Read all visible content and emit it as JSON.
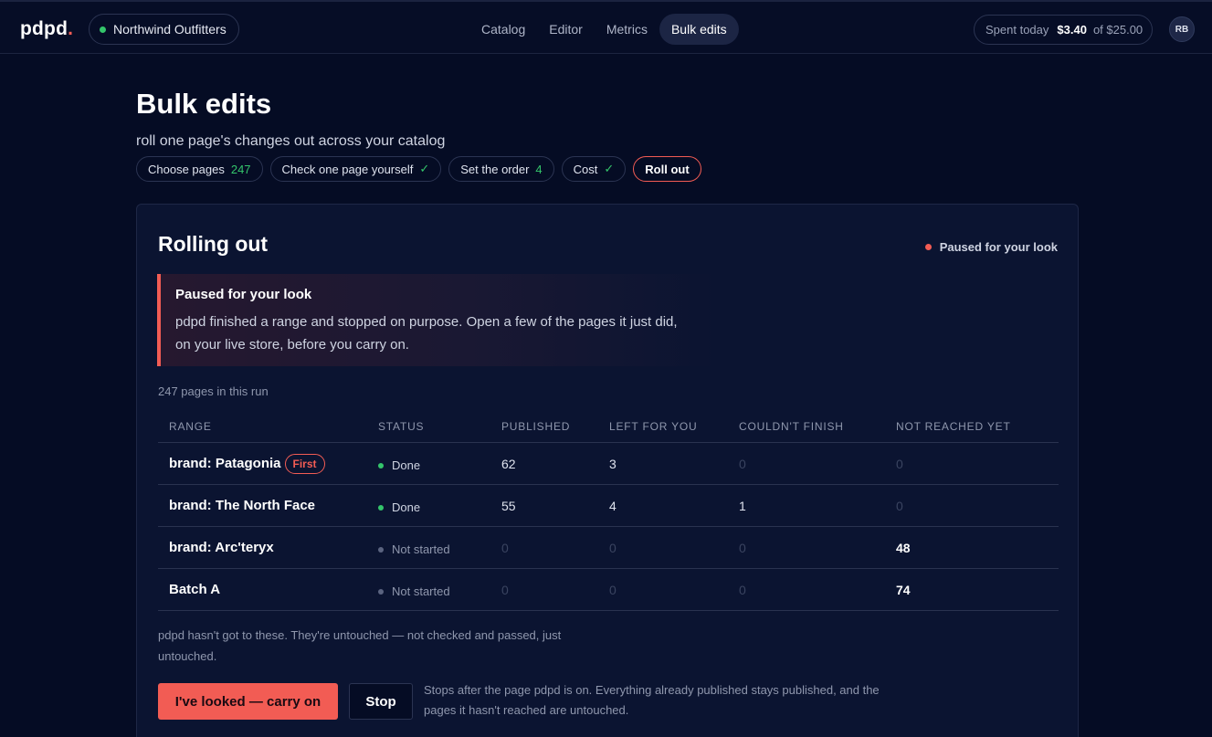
{
  "app": {
    "logo": "pdpd",
    "logo_dot": ".",
    "store_name": "Northwind Outfitters",
    "avatar_initials": "RB"
  },
  "nav": {
    "items": [
      {
        "label": "Catalog",
        "active": false
      },
      {
        "label": "Editor",
        "active": false
      },
      {
        "label": "Metrics",
        "active": false
      },
      {
        "label": "Bulk edits",
        "active": true
      }
    ]
  },
  "spend": {
    "label": "Spent today",
    "amount": "$3.40",
    "limit": "of $25.00"
  },
  "page": {
    "title": "Bulk edits",
    "subtitle": "roll one page's changes out across your catalog"
  },
  "steps": [
    {
      "label": "Choose pages",
      "extra": "247"
    },
    {
      "label": "Check one page yourself",
      "extra": "✓"
    },
    {
      "label": "Set the order",
      "extra": "4"
    },
    {
      "label": "Cost",
      "extra": "✓"
    },
    {
      "label": "Roll out",
      "extra": ""
    }
  ],
  "card": {
    "title": "Rolling out",
    "status": "Paused for your look",
    "alert_title": "Paused for your look",
    "alert_body": "pdpd finished a range and stopped on purpose. Open a few of the pages it just did, on your live store, before you carry on.",
    "count": "247 pages in this run"
  },
  "table": {
    "headers": [
      "RANGE",
      "STATUS",
      "PUBLISHED",
      "LEFT FOR YOU",
      "COULDN'T FINISH",
      "NOT REACHED YET"
    ],
    "rows": [
      {
        "range": "brand: Patagonia",
        "badge": "First",
        "status": "Done",
        "published": "62",
        "left": "3",
        "failed": "0",
        "not_reached": "0"
      },
      {
        "range": "brand: The North Face",
        "badge": "",
        "status": "Done",
        "published": "55",
        "left": "4",
        "failed": "1",
        "not_reached": "0"
      },
      {
        "range": "brand: Arc'teryx",
        "badge": "",
        "status": "Not started",
        "published": "0",
        "left": "0",
        "failed": "0",
        "not_reached": "48"
      },
      {
        "range": "Batch A",
        "badge": "",
        "status": "Not started",
        "published": "0",
        "left": "0",
        "failed": "0",
        "not_reached": "74"
      }
    ]
  },
  "footer": {
    "note": "pdpd hasn't got to these. They're untouched — not checked and passed, just untouched.",
    "primary_button": "I've looked — carry on",
    "stop_button": "Stop",
    "stop_note": "Stops after the page pdpd is on. Everything already published stays published, and the pages it hasn't reached are untouched."
  },
  "colors": {
    "accent": "#f25c54",
    "success": "#34c56b",
    "background": "#050c24",
    "card": "#0b1431"
  }
}
